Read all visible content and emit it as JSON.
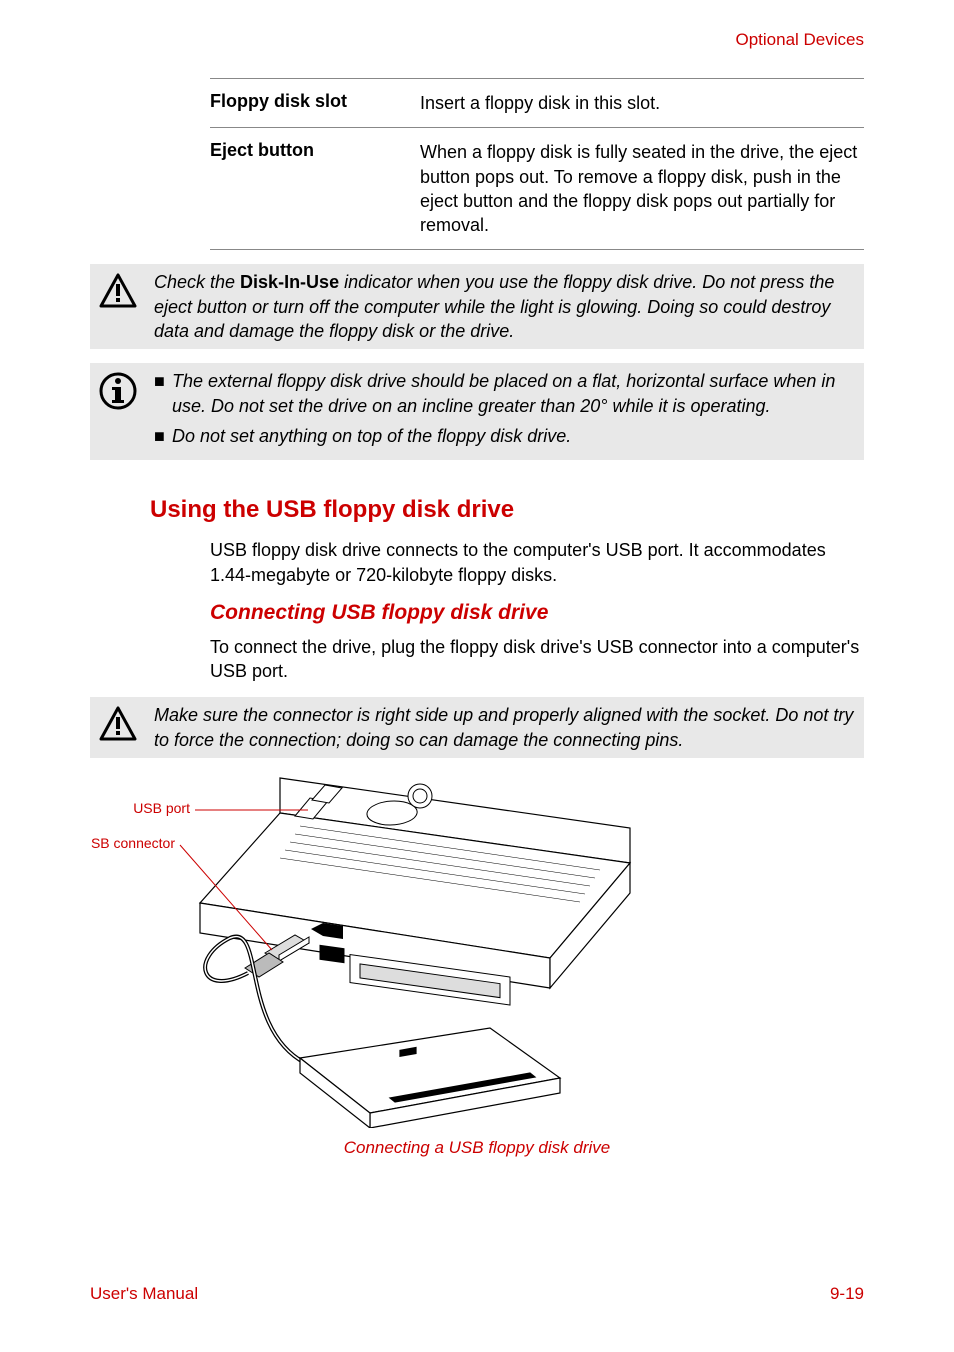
{
  "header": {
    "link": "Optional Devices"
  },
  "defs": [
    {
      "term": "Floppy disk slot",
      "desc": "Insert a floppy disk in this slot."
    },
    {
      "term": "Eject button",
      "desc": "When a floppy disk is fully seated in the drive, the eject button pops out. To remove a floppy disk, push in the eject button and the floppy disk pops out partially for removal."
    }
  ],
  "caution1": {
    "pre": "Check the ",
    "bold": "Disk-In-Use",
    "post": " indicator when you use the floppy disk drive. Do not press the eject button or turn off the computer while the light is glowing. Doing so could destroy data and damage the floppy disk or the drive."
  },
  "info1": {
    "bullets": [
      "The external floppy disk drive should be placed on a flat, horizontal surface when in use. Do not set the drive on an incline greater than 20° while it is operating.",
      "Do not set anything on top of the floppy disk drive."
    ]
  },
  "section": {
    "title": "Using the USB floppy disk drive"
  },
  "section_body": "USB floppy disk drive connects to the computer's USB port. It accommodates 1.44-megabyte or 720-kilobyte floppy disks.",
  "subsection": {
    "title": "Connecting USB floppy disk drive"
  },
  "subsection_body": "To connect the drive, plug the floppy disk drive's USB connector into a computer's USB port.",
  "caution2": "Make sure the connector is right side up and properly aligned with the socket. Do not try to force the connection; doing so can damage the connecting pins.",
  "figure": {
    "label_port": "USB port",
    "label_conn": "USB connector",
    "caption": "Connecting a USB floppy disk drive"
  },
  "footer": {
    "left": "User's Manual",
    "right": "9-19"
  }
}
